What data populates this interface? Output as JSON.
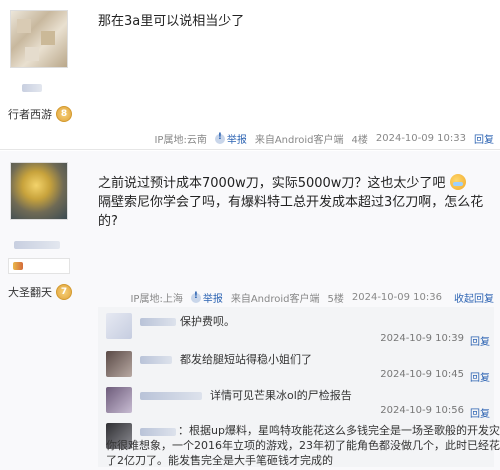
{
  "post1": {
    "content": "那在3a里可以说相当少了",
    "user_badge": "行者西游",
    "level": "8",
    "meta": {
      "ip": "IP属地:云南",
      "report": "举报",
      "client": "来自Android客户端",
      "floor": "4楼",
      "time": "2024-10-09 10:33",
      "reply": "回复"
    }
  },
  "post2": {
    "content_line1": "之前说过预计成本7000w刀，实际5000w刀？这也太少了吧",
    "content_line2": "隔壁索尼你学会了吗，有爆料特工总开发成本超过3亿刀啊，怎么花的?",
    "user_badge": "大圣翻天",
    "level": "7",
    "meta": {
      "ip": "IP属地:上海",
      "report": "举报",
      "client": "来自Android客户端",
      "floor": "5楼",
      "time": "2024-10-09 10:36",
      "reply": "收起回复"
    }
  },
  "replies": [
    {
      "text": "保护费呗。",
      "time": "2024-10-9 10:39",
      "reply": "回复"
    },
    {
      "text": "都发给腿短站得稳小姐们了",
      "time": "2024-10-9 10:45",
      "reply": "回复"
    },
    {
      "text": "详情可见芒果冰ol的尸检报告",
      "time": "2024-10-9 10:56",
      "reply": "回复"
    },
    {
      "line1": "：根据up爆料，星鸣特攻能花这么多钱完全是一场圣歌般的开发灾难，",
      "line2": "你很难想象，一个2016年立项的游戏，23年初了能角色都没做几个，此时已经花",
      "line3": "了2亿刀了。能发售完全是大手笔砸钱才完成的"
    }
  ],
  "colors": {
    "link": "#2d64b3",
    "reply_bg": "#f3f4f6"
  }
}
